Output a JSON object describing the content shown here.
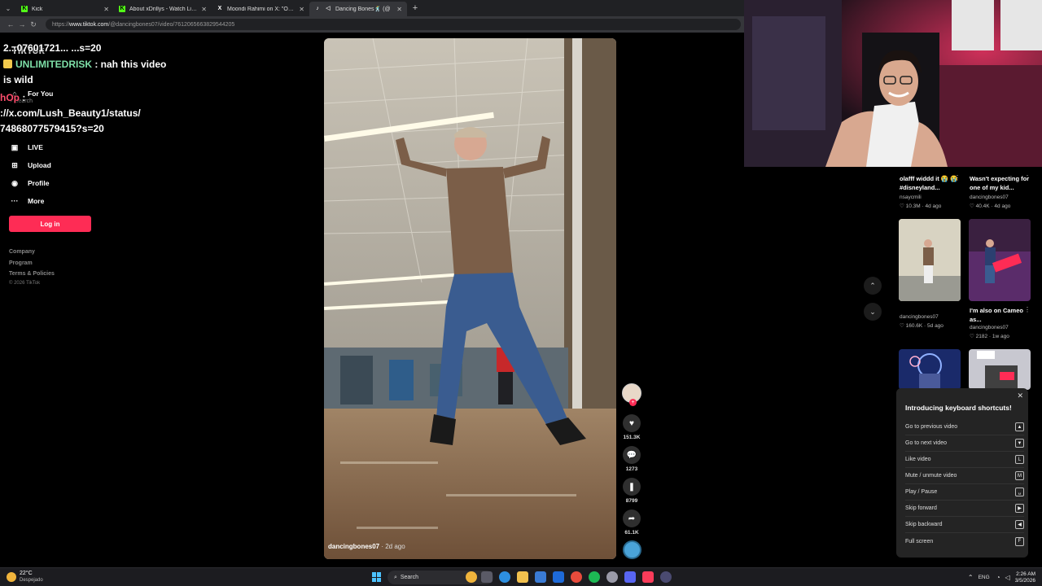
{
  "browser": {
    "tabs": [
      {
        "label": "Kick",
        "color": "#53fc18",
        "glyph": "K"
      },
      {
        "label": "About xDrillys - Watch Live on Kick",
        "color": "#53fc18",
        "glyph": "K"
      },
      {
        "label": "Moondi Rahimi on X: \"Ok yall, if yo",
        "color": "#ffffff",
        "glyph": "X"
      },
      {
        "label": "Dancing Bones🕺 (@",
        "color": "#ffffff",
        "glyph": "♪"
      }
    ],
    "url_prefix": "https://",
    "url_host": "www.tiktok.com",
    "url_path": "/@dancingbones07/video/7612065663829544205"
  },
  "sidebar": {
    "logo": "TikTok",
    "search_placeholder": "Search",
    "items": [
      {
        "label": "For You",
        "icon": "home-icon"
      },
      {
        "label": "LIVE",
        "icon": "live-icon"
      },
      {
        "label": "Upload",
        "icon": "plus-square-icon"
      },
      {
        "label": "Profile",
        "icon": "profile-icon"
      },
      {
        "label": "More",
        "icon": "more-icon"
      }
    ],
    "login": "Log in",
    "footer": [
      "Company",
      "Program",
      "Terms & Policies"
    ],
    "copyright": "© 2026 TikTok"
  },
  "chat": {
    "line1": "2...07601721... ...s=20",
    "user": "UNLIMITEDRISK",
    "msg1": " : nah this video",
    "msg2": "is wild",
    "user2": "hOp",
    "colon": " :",
    "link1": "://x.com/Lush_Beauty1/status/",
    "link2": "74868077579415?s=20"
  },
  "video": {
    "author": "dancingbones07",
    "age": " · 2d ago",
    "likes": "151.3K",
    "comments": "1273",
    "saves": "8799",
    "shares": "61.1K"
  },
  "related": [
    {
      "title": "olafff widdd it 😭 😭 #disneyland...",
      "author": "nsaycmili",
      "views": "10.3M",
      "age": "4d ago"
    },
    {
      "title": "Wasn't expecting for one of my kid...",
      "author": "dancingbones07",
      "views": "40.4K",
      "age": "4d ago"
    },
    {
      "title": "",
      "author": "dancingbones07",
      "views": "160.6K",
      "age": "5d ago"
    },
    {
      "title": "I'm also on Cameo as...",
      "author": "dancingbones07",
      "views": "2182",
      "age": "1w ago"
    }
  ],
  "shortcuts": {
    "title": "Introducing keyboard shortcuts!",
    "rows": [
      {
        "label": "Go to previous video",
        "key": "▲"
      },
      {
        "label": "Go to next video",
        "key": "▼"
      },
      {
        "label": "Like video",
        "key": "L"
      },
      {
        "label": "Mute / unmute video",
        "key": "M"
      },
      {
        "label": "Play / Pause",
        "key": "␣"
      },
      {
        "label": "Skip forward",
        "key": "▶"
      },
      {
        "label": "Skip backward",
        "key": "◀"
      },
      {
        "label": "Full screen",
        "key": "F"
      }
    ]
  },
  "taskbar": {
    "temp": "22°C",
    "weather": "Despejado",
    "search": "Search",
    "lang": "ENG",
    "time": "2:26 AM",
    "date": "3/5/2026"
  },
  "colors": {
    "accent": "#fe2c55",
    "kick_green": "#53fc18",
    "chat_user": "#7ee0a8"
  }
}
